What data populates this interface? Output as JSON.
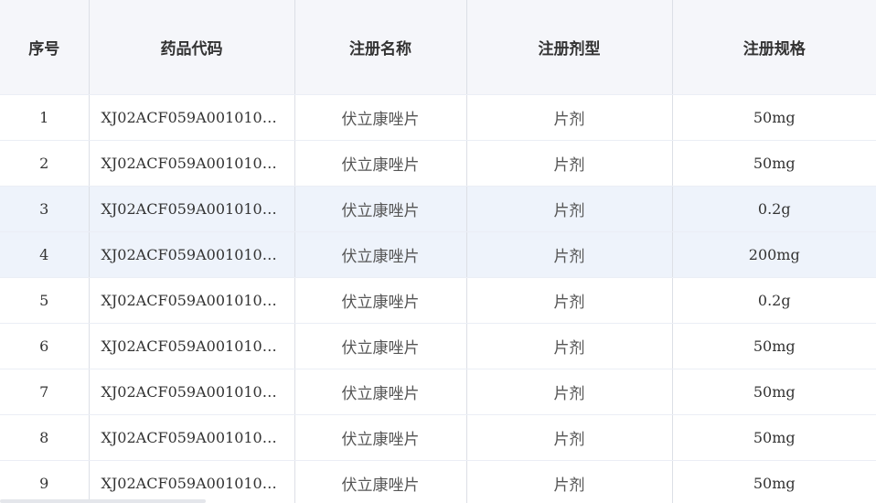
{
  "table": {
    "headers": {
      "index": "序号",
      "code": "药品代码",
      "name": "注册名称",
      "form": "注册剂型",
      "spec": "注册规格"
    },
    "rows": [
      {
        "index": "1",
        "code": "XJ02ACF059A00101010…",
        "name": "伏立康唑片",
        "form": "片剂",
        "spec": "50mg"
      },
      {
        "index": "2",
        "code": "XJ02ACF059A00101010…",
        "name": "伏立康唑片",
        "form": "片剂",
        "spec": "50mg"
      },
      {
        "index": "3",
        "code": "XJ02ACF059A00101010…",
        "name": "伏立康唑片",
        "form": "片剂",
        "spec": "0.2g"
      },
      {
        "index": "4",
        "code": "XJ02ACF059A00101010…",
        "name": "伏立康唑片",
        "form": "片剂",
        "spec": "200mg"
      },
      {
        "index": "5",
        "code": "XJ02ACF059A00101010…",
        "name": "伏立康唑片",
        "form": "片剂",
        "spec": "0.2g"
      },
      {
        "index": "6",
        "code": "XJ02ACF059A00101010…",
        "name": "伏立康唑片",
        "form": "片剂",
        "spec": "50mg"
      },
      {
        "index": "7",
        "code": "XJ02ACF059A00101010…",
        "name": "伏立康唑片",
        "form": "片剂",
        "spec": "50mg"
      },
      {
        "index": "8",
        "code": "XJ02ACF059A00101010…",
        "name": "伏立康唑片",
        "form": "片剂",
        "spec": "50mg"
      },
      {
        "index": "9",
        "code": "XJ02ACF059A00101010…",
        "name": "伏立康唑片",
        "form": "片剂",
        "spec": "50mg"
      }
    ]
  },
  "colors": {
    "header_bg": "#f5f6fa",
    "highlight_row_bg": "#eef3fb",
    "border": "#dcdfe6",
    "text": "#333333"
  }
}
